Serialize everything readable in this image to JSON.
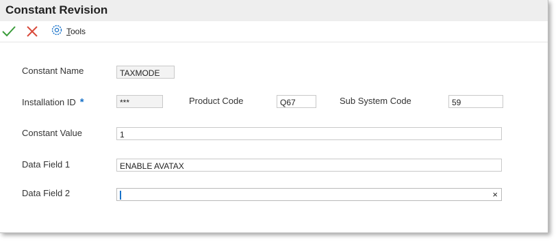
{
  "window": {
    "title": "Constant Revision"
  },
  "toolbar": {
    "ok_icon": "checkmark-icon",
    "cancel_icon": "close-icon",
    "tools_icon": "gear-icon",
    "tools_label_u": "T",
    "tools_label_rest": "ools"
  },
  "form": {
    "constant_name": {
      "label": "Constant Name",
      "value": "TAXMODE"
    },
    "installation_id": {
      "label": "Installation ID",
      "required_marker": "*",
      "value": "***"
    },
    "product_code": {
      "label": "Product Code",
      "value": "Q67"
    },
    "sub_system_code": {
      "label": "Sub System Code",
      "value": "59"
    },
    "constant_value": {
      "label": "Constant Value",
      "value": "1"
    },
    "data_field_1": {
      "label": "Data Field 1",
      "value": "ENABLE AVATAX"
    },
    "data_field_2": {
      "label": "Data Field 2",
      "value": "",
      "clear_glyph": "×"
    }
  },
  "colors": {
    "accent": "#1a73c9",
    "ok": "#3a9c3a",
    "cancel": "#d94a3a",
    "titlebar": "#eeeeee"
  }
}
